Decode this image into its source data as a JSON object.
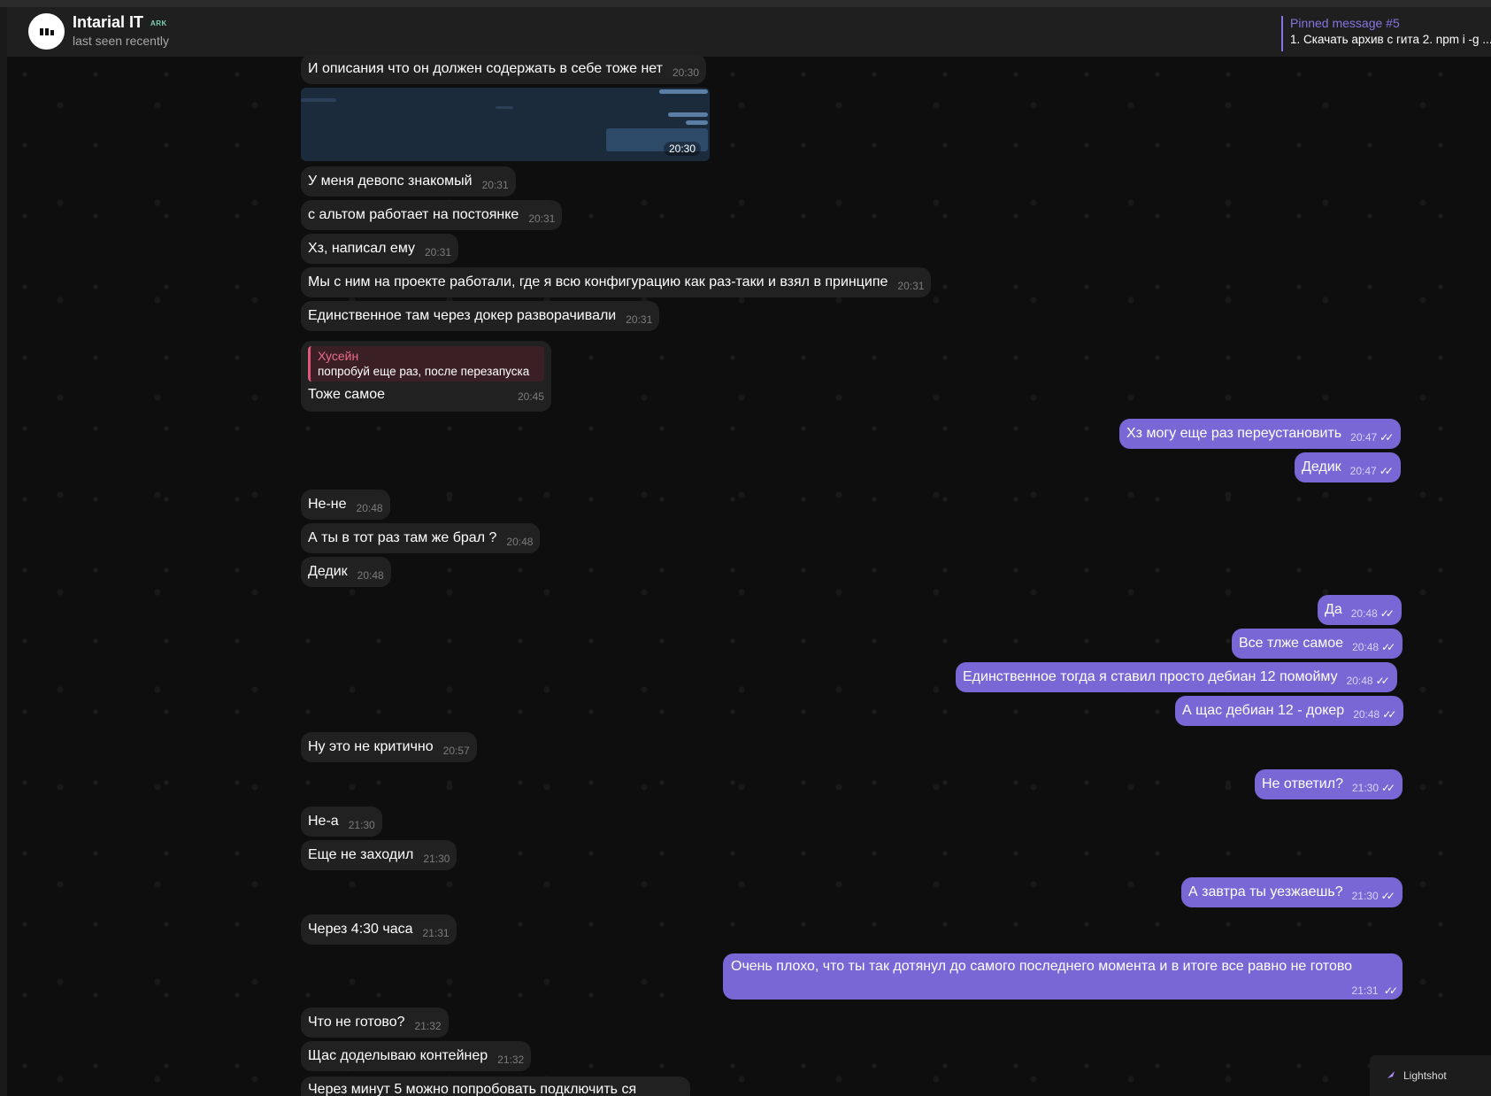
{
  "header": {
    "title": "Intarial IT",
    "badge": "ARK",
    "status": "last seen recently",
    "pinned_title": "Pinned message #5",
    "pinned_text": "1. Скачать архив с гита 2. npm i -g ..."
  },
  "photo": {
    "time": "20:30"
  },
  "reply": {
    "author": "Хусейн",
    "quoted": "попробуй еще раз, после перезапуска",
    "text": "Тоже самое",
    "time": "20:45"
  },
  "messages": [
    {
      "dir": "in",
      "text": "И описания что он должен содержать в себе тоже нет",
      "time": "20:30"
    },
    {
      "dir": "in",
      "text": "У меня девопс знакомый",
      "time": "20:31"
    },
    {
      "dir": "in",
      "text": "с альтом работает на постоянке",
      "time": "20:31"
    },
    {
      "dir": "in",
      "text": "Хз, написал ему",
      "time": "20:31"
    },
    {
      "dir": "in",
      "text": "Мы с ним на проекте работали, где я всю конфигурацию как раз-таки и взял в принципе",
      "time": "20:31"
    },
    {
      "dir": "in",
      "text": "Единственное там через докер разворачивали",
      "time": "20:31"
    },
    {
      "dir": "out",
      "text": "Хз могу еще раз переустановить",
      "time": "20:47"
    },
    {
      "dir": "out",
      "text": "Дедик",
      "time": "20:47"
    },
    {
      "dir": "in",
      "text": "Не-не",
      "time": "20:48"
    },
    {
      "dir": "in",
      "text": "А ты в тот раз там же брал ?",
      "time": "20:48"
    },
    {
      "dir": "in",
      "text": "Дедик",
      "time": "20:48"
    },
    {
      "dir": "out",
      "text": "Да",
      "time": "20:48"
    },
    {
      "dir": "out",
      "text": "Все тлже самое",
      "time": "20:48"
    },
    {
      "dir": "out",
      "text": "Единственное тогда я ставил просто дебиан 12 помойму",
      "time": "20:48"
    },
    {
      "dir": "out",
      "text": "А щас дебиан 12 - докер",
      "time": "20:48"
    },
    {
      "dir": "in",
      "text": "Ну это не критично",
      "time": "20:57"
    },
    {
      "dir": "out",
      "text": "Не ответил?",
      "time": "21:30"
    },
    {
      "dir": "in",
      "text": "Не-а",
      "time": "21:30"
    },
    {
      "dir": "in",
      "text": "Еще не заходил",
      "time": "21:30"
    },
    {
      "dir": "out",
      "text": "А завтра ты уезжаешь?",
      "time": "21:30"
    },
    {
      "dir": "in",
      "text": "Через 4:30 часа",
      "time": "21:31"
    },
    {
      "dir": "in",
      "text": "Что не готово?",
      "time": "21:32"
    },
    {
      "dir": "in",
      "text": "Щас доделываю контейнер",
      "time": "21:32"
    }
  ],
  "long_message": {
    "text": "Очень плохо, что ты так дотянул до самого последнего момента и в итоге все равно не готово",
    "time": "21:31"
  },
  "cut_message": {
    "text": "Через минут 5 можно попробовать подключить ся"
  },
  "ticks": "✓✓",
  "lightshot": {
    "label": "Lightshot"
  },
  "colors": {
    "outgoing": "#7a67d6",
    "incoming": "#212121",
    "accent": "#8774e1",
    "reply_author": "#ec6d8c"
  }
}
